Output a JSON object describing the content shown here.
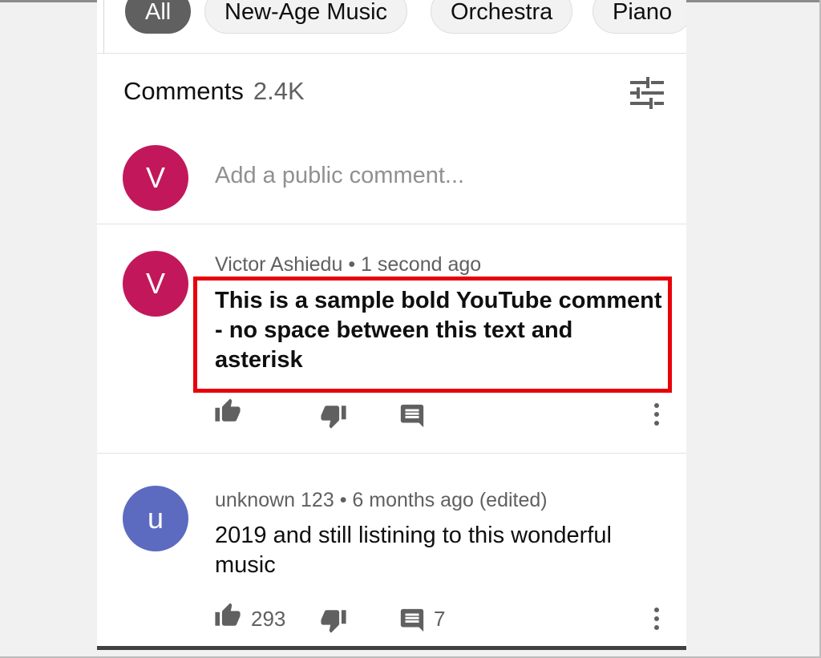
{
  "chips": [
    "All",
    "New-Age Music",
    "Orchestra",
    "Piano"
  ],
  "comments_header": {
    "title": "Comments",
    "count": "2.4K"
  },
  "add_comment": {
    "avatar_letter": "V",
    "placeholder": "Add a public comment..."
  },
  "comments": [
    {
      "avatar_letter": "V",
      "avatar_color": "#c2185b",
      "author": "Victor Ashiedu",
      "separator": "•",
      "time": "1 second ago",
      "text": "This is a sample bold YouTube comment - no space between this text and asterisk",
      "likes": "",
      "replies": ""
    },
    {
      "avatar_letter": "u",
      "avatar_color": "#5c6bc0",
      "author": "unknown 123",
      "separator": "•",
      "time": "6 months ago (edited)",
      "text": "2019 and still listining to this wonderful music",
      "likes": "293",
      "replies": "7"
    }
  ],
  "colors": {
    "highlight": "#e8000b",
    "avatar_v": "#c2185b",
    "avatar_u": "#5c6bc0"
  },
  "icons": [
    "sort-icon",
    "like-icon",
    "dislike-icon",
    "reply-icon",
    "more-icon"
  ]
}
